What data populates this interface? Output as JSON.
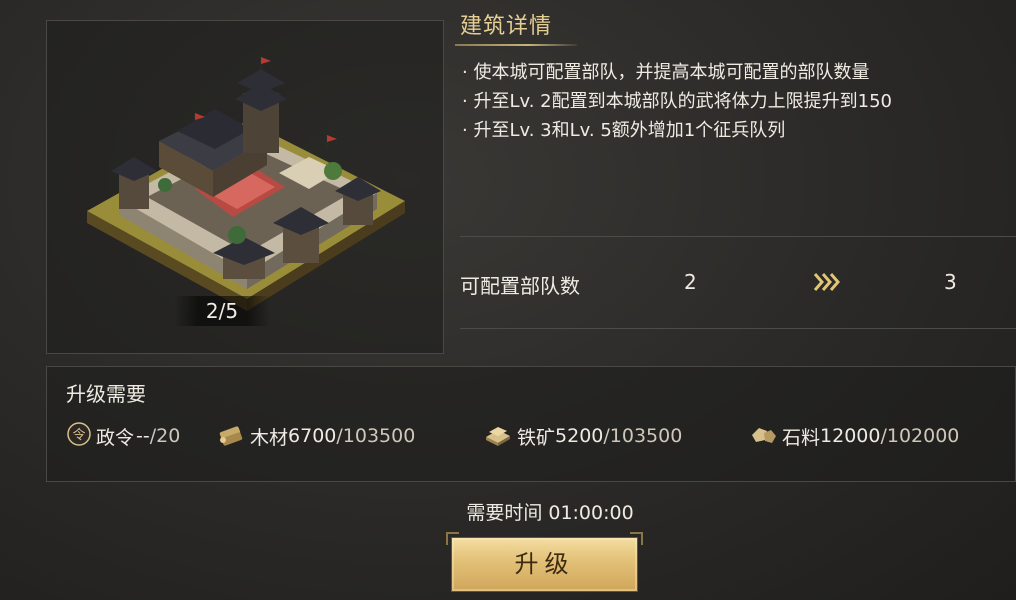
{
  "building": {
    "level": "2/5"
  },
  "detail": {
    "title": "建筑详情",
    "lines": [
      "· 使本城可配置部队，并提高本城可配置的部队数量",
      "· 升至Lv. 2配置到本城部队的武将体力上限提升到150",
      "· 升至Lv. 3和Lv. 5额外增加1个征兵队列"
    ]
  },
  "stat": {
    "label": "可配置部队数",
    "from": "2",
    "to": "3",
    "arrow_icon": "triple-chevron-right-icon"
  },
  "requirements": {
    "title": "升级需要",
    "items": [
      {
        "name": "政令",
        "have": "--",
        "need": "/20",
        "icon": "decree-token-icon"
      },
      {
        "name": "木材",
        "have": "6700",
        "need": "/103500",
        "icon": "wood-icon"
      },
      {
        "name": "铁矿",
        "have": "5200",
        "need": "/103500",
        "icon": "iron-ore-icon"
      },
      {
        "name": "石料",
        "have": "12000",
        "need": "/102000",
        "icon": "stone-icon"
      }
    ]
  },
  "time": {
    "text": "需要时间 01:00:00"
  },
  "upgrade": {
    "label": "升级"
  },
  "colors": {
    "accent_gold": "#e6cf93",
    "button_gold": "#e4c27a",
    "background": "#2a2927"
  }
}
